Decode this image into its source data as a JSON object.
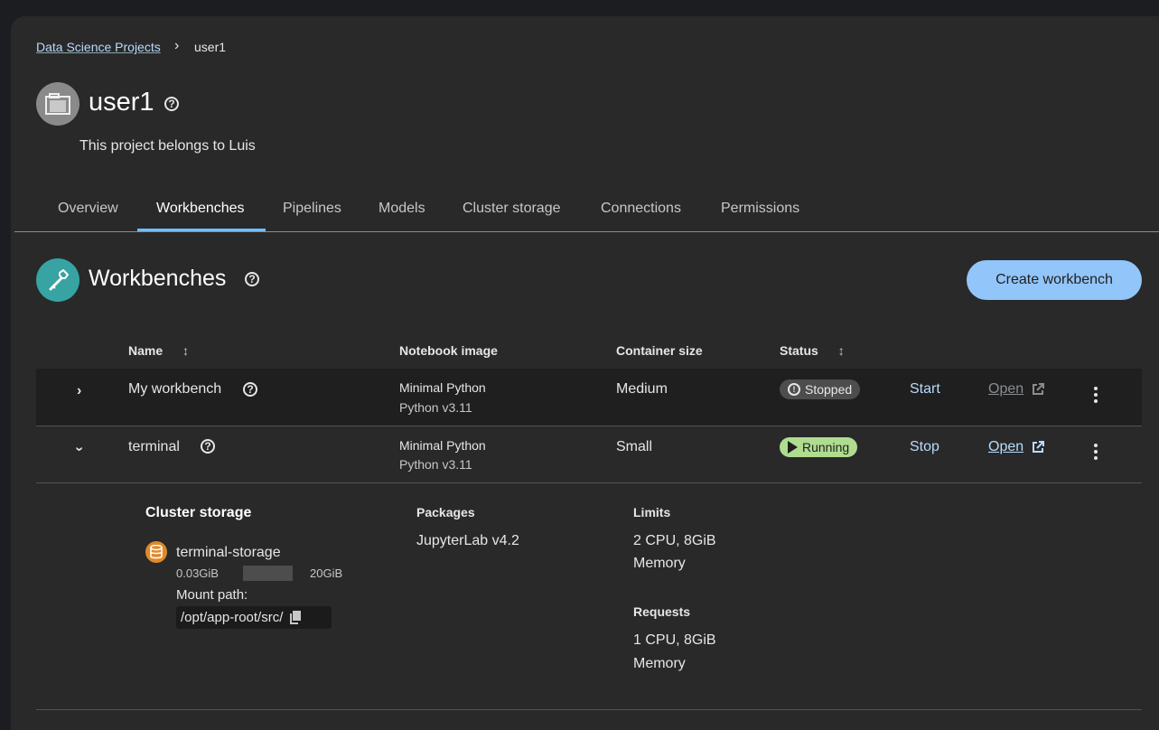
{
  "breadcrumb": {
    "parent": "Data Science Projects",
    "separator": "›",
    "current": "user1"
  },
  "project": {
    "title": "user1",
    "description": "This project belongs to Luis",
    "icon": "folder-icon"
  },
  "tabs": [
    {
      "label": "Overview"
    },
    {
      "label": "Workbenches",
      "active": true
    },
    {
      "label": "Pipelines"
    },
    {
      "label": "Models"
    },
    {
      "label": "Cluster storage"
    },
    {
      "label": "Connections"
    },
    {
      "label": "Permissions"
    }
  ],
  "section": {
    "title": "Workbenches",
    "icon": "wrench-icon",
    "create_label": "Create workbench"
  },
  "table": {
    "headers": {
      "name": "Name",
      "image": "Notebook image",
      "size": "Container size",
      "status": "Status"
    },
    "rows": [
      {
        "name": "My workbench",
        "image_name": "Minimal Python",
        "image_version": "Python v3.11",
        "size": "Medium",
        "status": "Stopped",
        "action": "Start",
        "open": "Open",
        "expanded": false
      },
      {
        "name": "terminal",
        "image_name": "Minimal Python",
        "image_version": "Python v3.11",
        "size": "Small",
        "status": "Running",
        "action": "Stop",
        "open": "Open",
        "expanded": true
      }
    ]
  },
  "details": {
    "storage_heading": "Cluster storage",
    "storage_name": "terminal-storage",
    "used": "0.03GiB",
    "total": "20GiB",
    "usage_fraction": 0.0015,
    "mount_label": "Mount path:",
    "mount_path": "/opt/app-root/src/",
    "packages_heading": "Packages",
    "packages_value": "JupyterLab v4.2",
    "limits_heading": "Limits",
    "limits_line1": "2 CPU, 8GiB",
    "limits_line2": "Memory",
    "requests_heading": "Requests",
    "requests_line1": "1 CPU, 8GiB",
    "requests_line2": "Memory"
  },
  "colors": {
    "accent": "#73bcf7",
    "primary_button": "#92c5f9",
    "running": "#afdc8f",
    "link": "#b9dafc"
  }
}
